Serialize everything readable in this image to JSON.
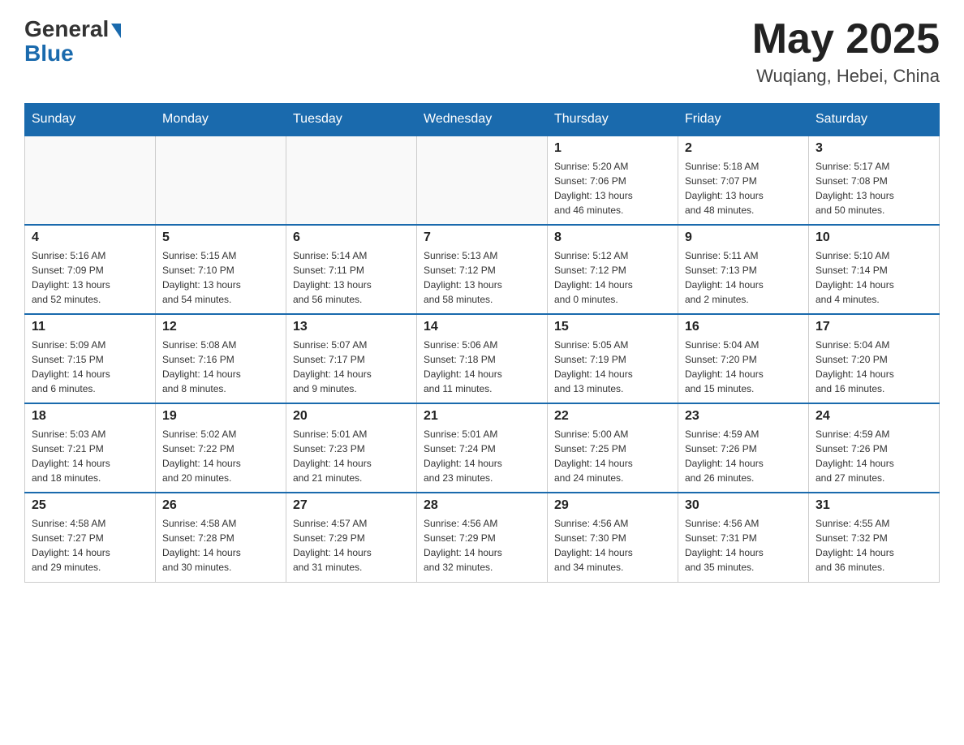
{
  "header": {
    "logo_general": "General",
    "logo_blue": "Blue",
    "month_title": "May 2025",
    "location": "Wuqiang, Hebei, China"
  },
  "days_of_week": [
    "Sunday",
    "Monday",
    "Tuesday",
    "Wednesday",
    "Thursday",
    "Friday",
    "Saturday"
  ],
  "weeks": [
    [
      {
        "day": "",
        "info": ""
      },
      {
        "day": "",
        "info": ""
      },
      {
        "day": "",
        "info": ""
      },
      {
        "day": "",
        "info": ""
      },
      {
        "day": "1",
        "info": "Sunrise: 5:20 AM\nSunset: 7:06 PM\nDaylight: 13 hours\nand 46 minutes."
      },
      {
        "day": "2",
        "info": "Sunrise: 5:18 AM\nSunset: 7:07 PM\nDaylight: 13 hours\nand 48 minutes."
      },
      {
        "day": "3",
        "info": "Sunrise: 5:17 AM\nSunset: 7:08 PM\nDaylight: 13 hours\nand 50 minutes."
      }
    ],
    [
      {
        "day": "4",
        "info": "Sunrise: 5:16 AM\nSunset: 7:09 PM\nDaylight: 13 hours\nand 52 minutes."
      },
      {
        "day": "5",
        "info": "Sunrise: 5:15 AM\nSunset: 7:10 PM\nDaylight: 13 hours\nand 54 minutes."
      },
      {
        "day": "6",
        "info": "Sunrise: 5:14 AM\nSunset: 7:11 PM\nDaylight: 13 hours\nand 56 minutes."
      },
      {
        "day": "7",
        "info": "Sunrise: 5:13 AM\nSunset: 7:12 PM\nDaylight: 13 hours\nand 58 minutes."
      },
      {
        "day": "8",
        "info": "Sunrise: 5:12 AM\nSunset: 7:12 PM\nDaylight: 14 hours\nand 0 minutes."
      },
      {
        "day": "9",
        "info": "Sunrise: 5:11 AM\nSunset: 7:13 PM\nDaylight: 14 hours\nand 2 minutes."
      },
      {
        "day": "10",
        "info": "Sunrise: 5:10 AM\nSunset: 7:14 PM\nDaylight: 14 hours\nand 4 minutes."
      }
    ],
    [
      {
        "day": "11",
        "info": "Sunrise: 5:09 AM\nSunset: 7:15 PM\nDaylight: 14 hours\nand 6 minutes."
      },
      {
        "day": "12",
        "info": "Sunrise: 5:08 AM\nSunset: 7:16 PM\nDaylight: 14 hours\nand 8 minutes."
      },
      {
        "day": "13",
        "info": "Sunrise: 5:07 AM\nSunset: 7:17 PM\nDaylight: 14 hours\nand 9 minutes."
      },
      {
        "day": "14",
        "info": "Sunrise: 5:06 AM\nSunset: 7:18 PM\nDaylight: 14 hours\nand 11 minutes."
      },
      {
        "day": "15",
        "info": "Sunrise: 5:05 AM\nSunset: 7:19 PM\nDaylight: 14 hours\nand 13 minutes."
      },
      {
        "day": "16",
        "info": "Sunrise: 5:04 AM\nSunset: 7:20 PM\nDaylight: 14 hours\nand 15 minutes."
      },
      {
        "day": "17",
        "info": "Sunrise: 5:04 AM\nSunset: 7:20 PM\nDaylight: 14 hours\nand 16 minutes."
      }
    ],
    [
      {
        "day": "18",
        "info": "Sunrise: 5:03 AM\nSunset: 7:21 PM\nDaylight: 14 hours\nand 18 minutes."
      },
      {
        "day": "19",
        "info": "Sunrise: 5:02 AM\nSunset: 7:22 PM\nDaylight: 14 hours\nand 20 minutes."
      },
      {
        "day": "20",
        "info": "Sunrise: 5:01 AM\nSunset: 7:23 PM\nDaylight: 14 hours\nand 21 minutes."
      },
      {
        "day": "21",
        "info": "Sunrise: 5:01 AM\nSunset: 7:24 PM\nDaylight: 14 hours\nand 23 minutes."
      },
      {
        "day": "22",
        "info": "Sunrise: 5:00 AM\nSunset: 7:25 PM\nDaylight: 14 hours\nand 24 minutes."
      },
      {
        "day": "23",
        "info": "Sunrise: 4:59 AM\nSunset: 7:26 PM\nDaylight: 14 hours\nand 26 minutes."
      },
      {
        "day": "24",
        "info": "Sunrise: 4:59 AM\nSunset: 7:26 PM\nDaylight: 14 hours\nand 27 minutes."
      }
    ],
    [
      {
        "day": "25",
        "info": "Sunrise: 4:58 AM\nSunset: 7:27 PM\nDaylight: 14 hours\nand 29 minutes."
      },
      {
        "day": "26",
        "info": "Sunrise: 4:58 AM\nSunset: 7:28 PM\nDaylight: 14 hours\nand 30 minutes."
      },
      {
        "day": "27",
        "info": "Sunrise: 4:57 AM\nSunset: 7:29 PM\nDaylight: 14 hours\nand 31 minutes."
      },
      {
        "day": "28",
        "info": "Sunrise: 4:56 AM\nSunset: 7:29 PM\nDaylight: 14 hours\nand 32 minutes."
      },
      {
        "day": "29",
        "info": "Sunrise: 4:56 AM\nSunset: 7:30 PM\nDaylight: 14 hours\nand 34 minutes."
      },
      {
        "day": "30",
        "info": "Sunrise: 4:56 AM\nSunset: 7:31 PM\nDaylight: 14 hours\nand 35 minutes."
      },
      {
        "day": "31",
        "info": "Sunrise: 4:55 AM\nSunset: 7:32 PM\nDaylight: 14 hours\nand 36 minutes."
      }
    ]
  ]
}
